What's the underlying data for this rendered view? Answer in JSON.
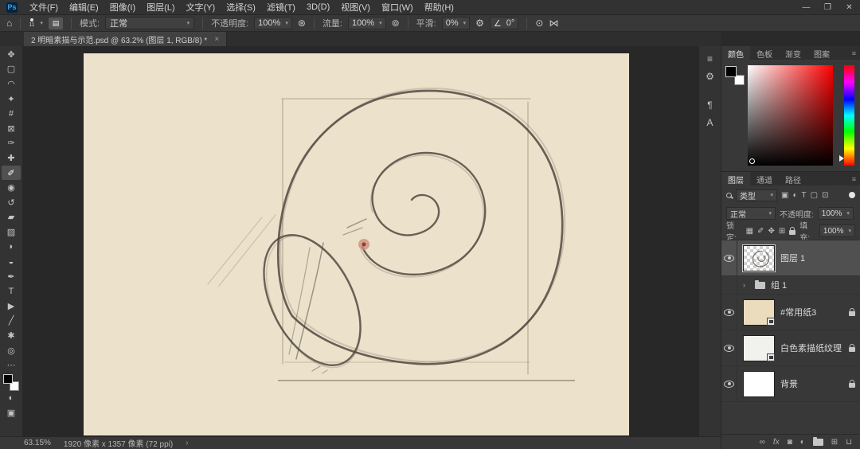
{
  "titlebar": {
    "logo": "Ps",
    "menus": [
      "文件(F)",
      "编辑(E)",
      "图像(I)",
      "图层(L)",
      "文字(Y)",
      "选择(S)",
      "滤镜(T)",
      "3D(D)",
      "视图(V)",
      "窗口(W)",
      "帮助(H)"
    ],
    "window_controls": {
      "minimize": "—",
      "maximize": "❒",
      "close": "✕"
    }
  },
  "options_bar": {
    "home_icon": "⌂",
    "brush_size": "11",
    "brush_panel_toggle": "▤",
    "mode_label": "模式:",
    "mode_value": "正常",
    "opacity_label": "不透明度:",
    "opacity_value": "100%",
    "pressure_opacity_icon": "⊛",
    "flow_label": "流量:",
    "flow_value": "100%",
    "airbrush_icon": "⊚",
    "smoothing_label": "平滑:",
    "smoothing_value": "0%",
    "gear_icon": "⚙",
    "angle_icon": "∠",
    "angle_value": "0°",
    "pressure_size_icon": "⊙",
    "symmetry_icon": "⋈"
  },
  "document_tab": {
    "title": "2 明暗素描与示范.psd @ 63.2% (图层 1, RGB/8) *",
    "close": "×"
  },
  "toolbar": {
    "tools": [
      {
        "name": "move",
        "glyph": "✥",
        "selected": false
      },
      {
        "name": "rectangular-marquee",
        "glyph": "▢",
        "selected": false
      },
      {
        "name": "lasso",
        "glyph": "◠",
        "selected": false
      },
      {
        "name": "quick-selection",
        "glyph": "✦",
        "selected": false
      },
      {
        "name": "crop",
        "glyph": "#",
        "selected": false
      },
      {
        "name": "frame",
        "glyph": "⊠",
        "selected": false
      },
      {
        "name": "eyedropper",
        "glyph": "✑",
        "selected": false
      },
      {
        "name": "spot-healing-brush",
        "glyph": "✚",
        "selected": false
      },
      {
        "name": "brush",
        "glyph": "✐",
        "selected": true
      },
      {
        "name": "clone-stamp",
        "glyph": "◉",
        "selected": false
      },
      {
        "name": "history-brush",
        "glyph": "↺",
        "selected": false
      },
      {
        "name": "eraser",
        "glyph": "▰",
        "selected": false
      },
      {
        "name": "gradient",
        "glyph": "▨",
        "selected": false
      },
      {
        "name": "blur",
        "glyph": "◗",
        "selected": false
      },
      {
        "name": "dodge",
        "glyph": "◒",
        "selected": false
      },
      {
        "name": "pen",
        "glyph": "✒",
        "selected": false
      },
      {
        "name": "type",
        "glyph": "T",
        "selected": false
      },
      {
        "name": "path-selection",
        "glyph": "▶",
        "selected": false
      },
      {
        "name": "shape",
        "glyph": "╱",
        "selected": false
      },
      {
        "name": "rotate-view",
        "glyph": "✱",
        "selected": false
      },
      {
        "name": "zoom",
        "glyph": "◎",
        "selected": false
      },
      {
        "name": "edit-toolbar",
        "glyph": "⋯",
        "selected": false
      }
    ],
    "quick_mask_icon": "◐",
    "screen_mode_icon": "▣"
  },
  "dock_strip": {
    "icons": [
      {
        "name": "adjustments",
        "glyph": "≡"
      },
      {
        "name": "libraries",
        "glyph": "⚙"
      },
      {
        "name": "paragraph",
        "glyph": "¶"
      },
      {
        "name": "character",
        "glyph": "A"
      }
    ]
  },
  "color_panel": {
    "tabs": [
      "颜色",
      "色板",
      "渐变",
      "图案"
    ],
    "active_tab": "颜色",
    "panel_menu_icon": "≡",
    "foreground_color": "#000000",
    "background_color": "#ffffff"
  },
  "layers_panel": {
    "tabs": [
      "图层",
      "通道",
      "路径"
    ],
    "active_tab": "图层",
    "panel_menu_icon": "≡",
    "filter_label": "类型",
    "filter_icons": [
      "▣",
      "◐",
      "T",
      "▢",
      "⊡"
    ],
    "blend_mode": "正常",
    "opacity_label": "不透明度:",
    "opacity_value": "100%",
    "lock_label": "锁定:",
    "lock_icons": [
      "▦",
      "✐",
      "✥",
      "⊞"
    ],
    "fill_label": "填充:",
    "fill_value": "100%",
    "layers": [
      {
        "name": "图层 1",
        "visible": true,
        "selected": true,
        "locked": false,
        "thumb": "spiral-on-transparent"
      },
      {
        "name": "组 1",
        "type": "group",
        "visible": false,
        "collapsed": true
      },
      {
        "name": "#常用纸3",
        "visible": true,
        "locked": true,
        "thumb": "beige-paper",
        "smart_object": true
      },
      {
        "name": "白色素描纸纹理",
        "visible": true,
        "locked": true,
        "thumb": "white-paper",
        "smart_object": true
      },
      {
        "name": "背景",
        "visible": true,
        "locked": true,
        "thumb": "white"
      }
    ],
    "footer_icons": [
      {
        "name": "link-layers",
        "glyph": "∞"
      },
      {
        "name": "layer-style",
        "glyph": "fx"
      },
      {
        "name": "add-layer-mask",
        "glyph": "◙"
      },
      {
        "name": "add-adjustment-layer",
        "glyph": "◐"
      },
      {
        "name": "new-group",
        "glyph": ""
      },
      {
        "name": "new-layer",
        "glyph": "⊞"
      },
      {
        "name": "delete-layer",
        "glyph": "⊔"
      }
    ]
  },
  "status_bar": {
    "zoom": "63.15%",
    "doc_info": "1920 像素 x 1357 像素 (72 ppi)",
    "chevron": "›"
  },
  "canvas": {
    "description": "铅笔素描：鹦鹉螺壳螺旋结构稿（带辅助方框与椭圆开口）",
    "paper_color": "#ece2cb",
    "pencil_color": "#4a423a",
    "brush_cursor_color": "#d08a77"
  }
}
